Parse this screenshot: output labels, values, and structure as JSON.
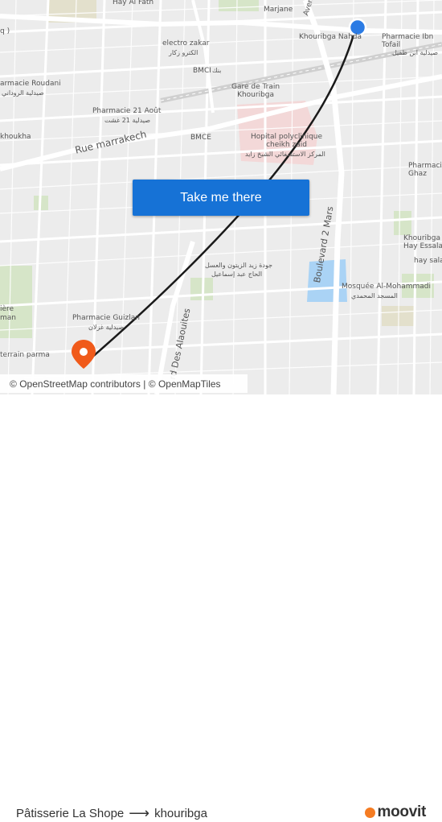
{
  "map": {
    "cta_label": "Take me there",
    "attribution": {
      "copyright": "©",
      "osm_contributors": "OpenStreetMap contributors",
      "separator": "|",
      "omt": "OpenMapTiles"
    },
    "labels": {
      "hay_al_fath": "Hay Al Fath",
      "marjane": "Marjane",
      "avenue": "Avenue",
      "khouribga_nahda": "Khouribga Nahda",
      "pharmacie_ibn_tofail": "Pharmacie Ibn\nTofail",
      "pharmacie_ibn_tofail_ar": "صيدلية ابن طفيل",
      "electro_zakar": "electro zakar",
      "electro_zakar_ar": "الكترو زكار",
      "bmci": "BMCI",
      "bmci_ar": "بنك",
      "pharmacie_roudani": "armacie Roudani",
      "pharmacie_roudani_ar": "صيدلية الروداني",
      "gare": "Gare de Train\nKhouribga",
      "pharmacie_21_aout": "Pharmacie 21 Août",
      "pharmacie_21_aout_ar": "صيدلية 21 غشت",
      "rue_marrakech": "Rue marrakech",
      "bmce": "BMCE",
      "hopital": "Hopital polyclinique\ncheikh zaid",
      "hopital_ar": "المركز الاستشفائي الشيخ زايد",
      "pharmacie_ghaz": "Pharmacie\nGhaz",
      "boulevard_2_mars": "Boulevard 2 Mars",
      "khouribga_hay_essalam": "Khouribga\nHay Essalam",
      "hay_salam": "hay salam",
      "mosquee": "Mosquée Al-Mohammadi",
      "mosquee_ar": "المسجد المحمدي",
      "jawda_zaid": "جودة زيد الزيتون والعسل",
      "jawda_zaid_2": "الحاج عبد إسماعيل",
      "pharmacie_guizlan": "Pharmacie Guizlan",
      "pharmacie_guizlan_ar": "صيدلية غزلان",
      "terrain_parma": "terrain parma",
      "boulevard_des_alaouites": "rd Des Alaouites",
      "khoukha": "khoukha",
      "iere": "ière",
      "man": "man",
      "left_q": "q )"
    }
  },
  "footer": {
    "origin": "Pâtisserie La Shope",
    "destination": "khouribga",
    "brand": "moovit"
  },
  "colors": {
    "route": "#1a1a1a",
    "origin_dot": "#2b7be4",
    "destination_pin": "#f05a1a",
    "cta": "#1672d6",
    "brand_dot": "#f57c22"
  }
}
